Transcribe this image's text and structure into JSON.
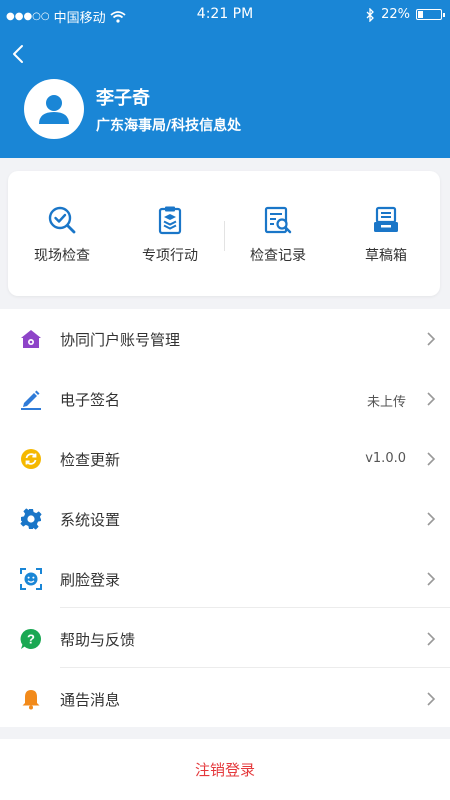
{
  "status_bar": {
    "carrier": "中国移动",
    "time": "4:21 PM",
    "battery": "22%",
    "battery_level": 0.22
  },
  "profile": {
    "name": "李子奇",
    "organization": "广东海事局/科技信息处"
  },
  "quick_actions": [
    {
      "label": "现场检查",
      "icon": "magnify-check-icon"
    },
    {
      "label": "专项行动",
      "icon": "clipboard-badge-icon"
    },
    {
      "label": "检查记录",
      "icon": "document-search-icon"
    },
    {
      "label": "草稿箱",
      "icon": "drafts-tray-icon"
    }
  ],
  "menu": [
    {
      "label": "协同门户账号管理",
      "value": "",
      "icon": "home-icon",
      "color": "#8e44c8"
    },
    {
      "label": "电子签名",
      "value": "未上传",
      "icon": "pen-signature-icon",
      "color": "#2f7bd8"
    },
    {
      "label": "检查更新",
      "value": "v1.0.0",
      "icon": "refresh-icon",
      "color": "#f5b800"
    },
    {
      "label": "系统设置",
      "value": "",
      "icon": "gear-icon",
      "color": "#1a76c8"
    },
    {
      "label": "刷脸登录",
      "value": "",
      "icon": "face-scan-icon",
      "color": "#1a86d6"
    },
    {
      "label": "帮助与反馈",
      "value": "",
      "icon": "help-bubble-icon",
      "color": "#1ba853"
    },
    {
      "label": "通告消息",
      "value": "",
      "icon": "bell-icon",
      "color": "#f28a1a"
    }
  ],
  "logout": {
    "label": "注销登录",
    "color": "#e4393c"
  },
  "colors": {
    "header": "#1a86d6",
    "background": "#f2f3f6",
    "icon_blue": "#1a76c8"
  }
}
